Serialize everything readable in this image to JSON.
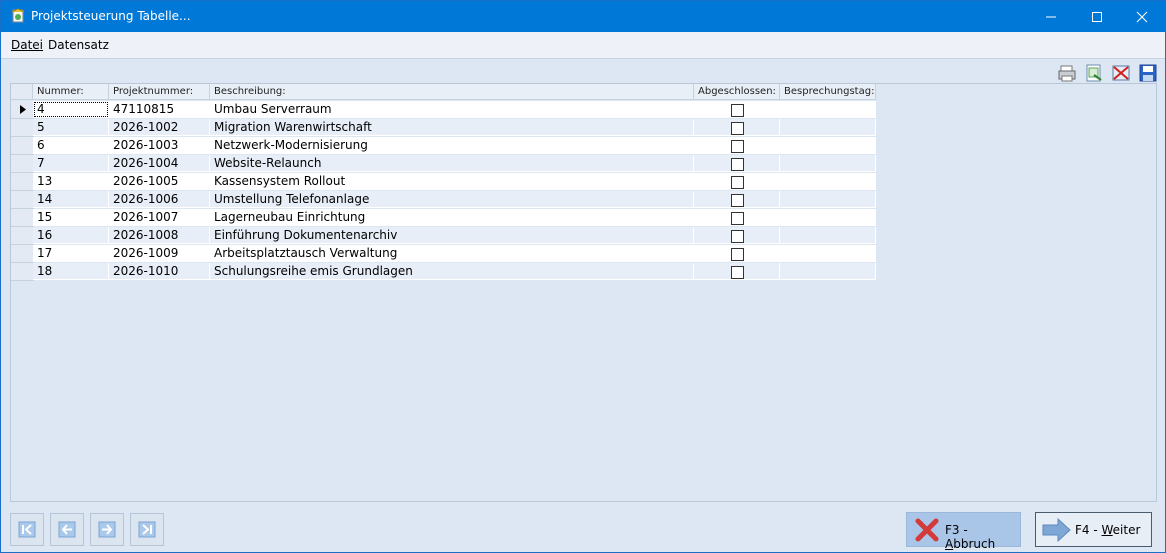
{
  "window": {
    "title": "Projektsteuerung Tabelle..."
  },
  "menu": {
    "file": "Datei",
    "record": "Datensatz"
  },
  "toolbar": {
    "icons": [
      "print-icon",
      "export-icon",
      "delete-icon",
      "save-icon"
    ]
  },
  "grid": {
    "headers": {
      "nummer": "Nummer:",
      "projektnummer": "Projektnummer:",
      "beschreibung": "Beschreibung:",
      "abgeschlossen": "Abgeschlossen:",
      "besprechungstag": "Besprechungstag:"
    },
    "rows": [
      {
        "nummer": "4",
        "projektnummer": "47110815",
        "beschreibung": "Umbau Serverraum",
        "abgeschlossen": false,
        "besprechungstag": ""
      },
      {
        "nummer": "5",
        "projektnummer": "2026-1002",
        "beschreibung": "Migration Warenwirtschaft",
        "abgeschlossen": false,
        "besprechungstag": ""
      },
      {
        "nummer": "6",
        "projektnummer": "2026-1003",
        "beschreibung": "Netzwerk-Modernisierung",
        "abgeschlossen": false,
        "besprechungstag": ""
      },
      {
        "nummer": "7",
        "projektnummer": "2026-1004",
        "beschreibung": "Website-Relaunch",
        "abgeschlossen": false,
        "besprechungstag": ""
      },
      {
        "nummer": "13",
        "projektnummer": "2026-1005",
        "beschreibung": "Kassensystem Rollout",
        "abgeschlossen": false,
        "besprechungstag": ""
      },
      {
        "nummer": "14",
        "projektnummer": "2026-1006",
        "beschreibung": "Umstellung Telefonanlage",
        "abgeschlossen": false,
        "besprechungstag": ""
      },
      {
        "nummer": "15",
        "projektnummer": "2026-1007",
        "beschreibung": "Lagerneubau Einrichtung",
        "abgeschlossen": false,
        "besprechungstag": ""
      },
      {
        "nummer": "16",
        "projektnummer": "2026-1008",
        "beschreibung": "Einführung Dokumentenarchiv",
        "abgeschlossen": false,
        "besprechungstag": ""
      },
      {
        "nummer": "17",
        "projektnummer": "2026-1009",
        "beschreibung": "Arbeitsplatztausch Verwaltung",
        "abgeschlossen": false,
        "besprechungstag": ""
      },
      {
        "nummer": "18",
        "projektnummer": "2026-1010",
        "beschreibung": "Schulungsreihe emis Grundlagen",
        "abgeschlossen": false,
        "besprechungstag": ""
      }
    ]
  },
  "buttons": {
    "cancel_prefix": "F3 - ",
    "cancel_key": "A",
    "cancel_rest": "bbruch",
    "next_prefix": "F4 - ",
    "next_key": "W",
    "next_rest": "eiter"
  },
  "colors": {
    "titlebar": "#0078d7",
    "row_even": "#ffffff",
    "row_odd": "#e7eef7"
  }
}
